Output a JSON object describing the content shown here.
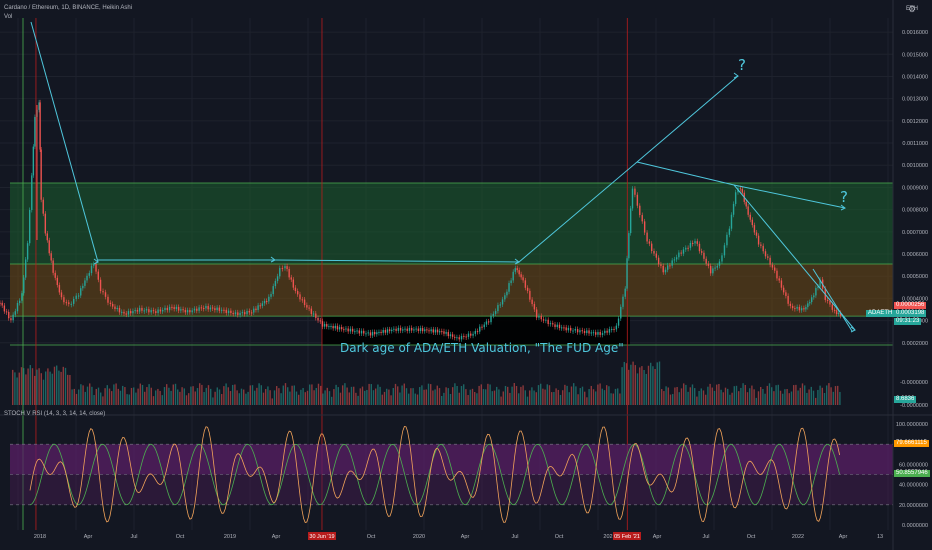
{
  "header": {
    "title": "Cardano / Ethereum, 1D, BINANCE, Heikin Ashi",
    "vol_label": "Vol",
    "currency": "ETH",
    "settings_icon": "gear-icon"
  },
  "oscillator": {
    "title": "STOCH V RSI (14, 3, 3, 14, 14, close)"
  },
  "annotation": {
    "text": "Dark age of ADA/ETH Valuation, \"The FUD Age\"",
    "question_marks": [
      "?",
      "?"
    ],
    "color": "#4fc7dc"
  },
  "price_tags": {
    "red": "0.0000256",
    "pair": "ADAETH",
    "pair_value": "0.0003198",
    "countdown": "09:31:23",
    "vol_value": "8.6836",
    "osc_upper": "79.6661115",
    "osc_lower": "50.8557946"
  },
  "colors": {
    "background": "#131722",
    "up": "#26a69a",
    "down": "#ef5350",
    "green_zone": "#1f7a3a",
    "orange_zone": "#8a5a1a",
    "cyan": "#4fc7dc",
    "osc_band": "#6b2a7a",
    "k_line": "#f2a35a",
    "d_line": "#4caf50"
  },
  "chart_data": [
    {
      "type": "line",
      "title": "Cardano / Ethereum, 1D, BINANCE, Heikin Ashi",
      "style": "heikin-ashi",
      "y_unit": "ETH",
      "y_axis_labels": [
        "0.0000000",
        "0.0001000",
        "0.0002000",
        "0.0003000",
        "0.0004000",
        "0.0005000",
        "0.0006000",
        "0.0007000",
        "0.0008000",
        "0.0009000",
        "0.0010000",
        "0.0011000",
        "0.0012000",
        "0.0013000",
        "0.0014000",
        "0.0015000",
        "0.0016000"
      ],
      "y_range": [
        1e-05,
        0.00172
      ],
      "x_axis_labels": [
        "2018",
        "Apr",
        "Jul",
        "Oct",
        "2019",
        "Apr",
        "30 Jun '19",
        "Oct",
        "2020",
        "Apr",
        "Jul",
        "Oct",
        "202",
        "05 Feb '21",
        "Apr",
        "Jul",
        "Oct",
        "2022",
        "Apr",
        "13"
      ],
      "x_range": [
        "2017-10-20",
        "2022-06-30"
      ],
      "grid": true,
      "series": [
        {
          "values": [
            [
              "2017-10-20",
              0.00038
            ],
            [
              "2017-11-10",
              0.0003
            ],
            [
              "2017-12-01",
              0.00042
            ],
            [
              "2017-12-12",
              0.00065
            ],
            [
              "2017-12-20",
              0.00095
            ],
            [
              "2017-12-26",
              0.00122
            ],
            [
              "2018-01-03",
              0.00128
            ],
            [
              "2018-01-07",
              0.00085
            ],
            [
              "2018-01-15",
              0.0007
            ],
            [
              "2018-01-30",
              0.00052
            ],
            [
              "2018-02-15",
              0.0004
            ],
            [
              "2018-03-01",
              0.00037
            ],
            [
              "2018-03-20",
              0.00042
            ],
            [
              "2018-04-05",
              0.0005
            ],
            [
              "2018-04-18",
              0.00056
            ],
            [
              "2018-05-01",
              0.00044
            ],
            [
              "2018-05-20",
              0.00037
            ],
            [
              "2018-06-15",
              0.00033
            ],
            [
              "2018-07-15",
              0.00035
            ],
            [
              "2018-08-15",
              0.00034
            ],
            [
              "2018-09-15",
              0.00036
            ],
            [
              "2018-10-15",
              0.00034
            ],
            [
              "2018-11-15",
              0.00036
            ],
            [
              "2018-12-15",
              0.00035
            ],
            [
              "2019-01-15",
              0.00033
            ],
            [
              "2019-02-15",
              0.00034
            ],
            [
              "2019-03-20",
              0.0004
            ],
            [
              "2019-04-10",
              0.00053
            ],
            [
              "2019-04-20",
              0.00055
            ],
            [
              "2019-05-10",
              0.00043
            ],
            [
              "2019-06-01",
              0.00036
            ],
            [
              "2019-07-01",
              0.00028
            ],
            [
              "2019-08-15",
              0.00026
            ],
            [
              "2019-10-01",
              0.00024
            ],
            [
              "2019-11-15",
              0.00026
            ],
            [
              "2020-01-01",
              0.00026
            ],
            [
              "2020-02-15",
              0.00025
            ],
            [
              "2020-03-15",
              0.00022
            ],
            [
              "2020-04-15",
              0.00024
            ],
            [
              "2020-05-15",
              0.0003
            ],
            [
              "2020-06-15",
              0.00041
            ],
            [
              "2020-07-05",
              0.00054
            ],
            [
              "2020-07-20",
              0.00048
            ],
            [
              "2020-08-15",
              0.00032
            ],
            [
              "2020-09-15",
              0.00028
            ],
            [
              "2020-10-15",
              0.00026
            ],
            [
              "2020-11-15",
              0.00025
            ],
            [
              "2020-12-15",
              0.00024
            ],
            [
              "2021-01-15",
              0.00027
            ],
            [
              "2021-02-01",
              0.00045
            ],
            [
              "2021-02-08",
              0.0007
            ],
            [
              "2021-02-15",
              0.0009
            ],
            [
              "2021-03-01",
              0.00078
            ],
            [
              "2021-03-15",
              0.00066
            ],
            [
              "2021-04-15",
              0.00052
            ],
            [
              "2021-05-15",
              0.0006
            ],
            [
              "2021-06-15",
              0.00066
            ],
            [
              "2021-07-15",
              0.00052
            ],
            [
              "2021-08-01",
              0.00056
            ],
            [
              "2021-08-20",
              0.00072
            ],
            [
              "2021-09-01",
              0.00088
            ],
            [
              "2021-09-10",
              0.0009
            ],
            [
              "2021-09-25",
              0.00078
            ],
            [
              "2021-10-15",
              0.00065
            ],
            [
              "2021-11-15",
              0.00052
            ],
            [
              "2021-12-15",
              0.00036
            ],
            [
              "2022-01-10",
              0.00035
            ],
            [
              "2022-01-25",
              0.0004
            ],
            [
              "2022-02-10",
              0.00048
            ],
            [
              "2022-02-20",
              0.0004
            ],
            [
              "2022-03-10",
              0.00034
            ],
            [
              "2022-03-25",
              0.00032
            ]
          ]
        }
      ],
      "zones": [
        {
          "from": 0.00032,
          "to": 0.000555,
          "color": "orange"
        },
        {
          "from": 0.000555,
          "to": 0.00092,
          "color": "green"
        },
        {
          "from": 0.00019,
          "to": 0.00032,
          "color": "black"
        }
      ],
      "horizontal_lines": [
        0.00092,
        0.000555,
        0.00032,
        0.00019
      ],
      "vertical_markers": [
        "2017-12-28",
        "2019-06-30",
        "2021-02-05"
      ]
    },
    {
      "type": "line",
      "title": "STOCH V RSI (14, 3, 3, 14, 14, close)",
      "y_axis_labels": [
        "0.0000000",
        "20.0000000",
        "40.0000000",
        "60.0000000",
        "100.0000000"
      ],
      "y_range": [
        -5,
        105
      ],
      "bands": [
        80,
        50,
        20
      ]
    }
  ]
}
